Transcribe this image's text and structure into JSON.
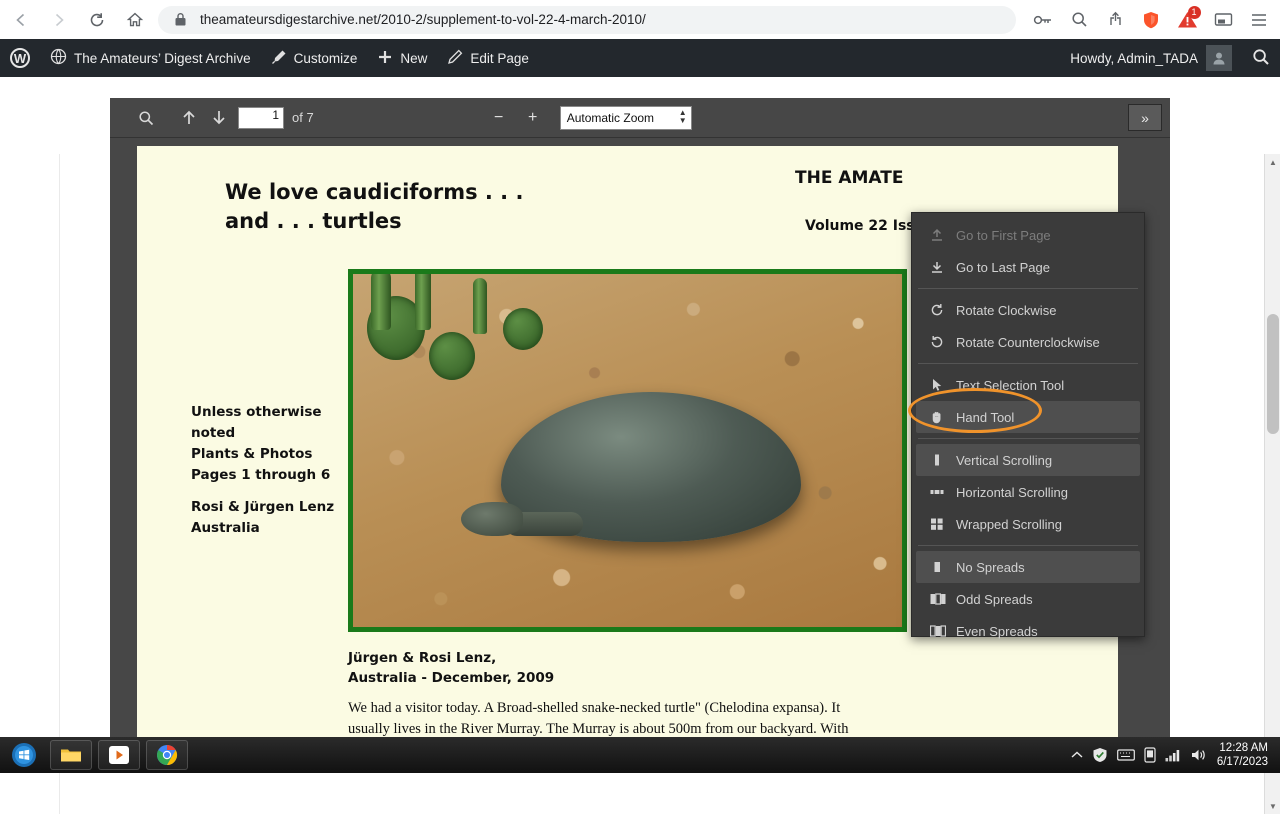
{
  "browser": {
    "url": "theamateursdigestarchive.net/2010-2/supplement-to-vol-22-4-march-2010/",
    "back_icon": "back-arrow-icon",
    "forward_icon": "forward-arrow-icon",
    "reload_icon": "reload-icon",
    "home_icon": "home-icon",
    "lock_icon": "lock-icon",
    "key_icon": "key-icon",
    "zoom_icon": "magnifier-icon",
    "share_icon": "share-icon",
    "shield_icon": "brave-shield-icon",
    "warning_icon": "warning-triangle-icon",
    "warning_badge": "1",
    "cast_icon": "cast-icon",
    "menu_icon": "hamburger-menu-icon"
  },
  "adminbar": {
    "logo": "wordpress-logo-icon",
    "site_name": "The Amateurs’ Digest Archive",
    "customize": "Customize",
    "new": "New",
    "edit_page": "Edit Page",
    "howdy": "Howdy, Admin_TADA",
    "search_icon": "search-icon"
  },
  "pdf_toolbar": {
    "find_icon": "magnifier-icon",
    "prev_page_icon": "up-arrow-icon",
    "next_page_icon": "down-arrow-icon",
    "page_number": "1",
    "page_count_label": "of 7",
    "zoom_out": "−",
    "zoom_in": "+",
    "zoom_level": "Automatic Zoom",
    "secondary_toggle": "»"
  },
  "secondary_menu": {
    "items": [
      {
        "label": "Go to First Page",
        "icon": "first-page-icon",
        "state": "disabled"
      },
      {
        "label": "Go to Last Page",
        "icon": "last-page-icon",
        "state": "normal"
      },
      {
        "label": "Rotate Clockwise",
        "icon": "rotate-cw-icon",
        "state": "normal"
      },
      {
        "label": "Rotate Counterclockwise",
        "icon": "rotate-ccw-icon",
        "state": "normal"
      },
      {
        "label": "Text Selection Tool",
        "icon": "cursor-arrow-icon",
        "state": "normal"
      },
      {
        "label": "Hand Tool",
        "icon": "hand-icon",
        "state": "selected"
      },
      {
        "label": "Vertical Scrolling",
        "icon": "vertical-scroll-icon",
        "state": "selected"
      },
      {
        "label": "Horizontal Scrolling",
        "icon": "horizontal-scroll-icon",
        "state": "normal"
      },
      {
        "label": "Wrapped Scrolling",
        "icon": "wrapped-scroll-icon",
        "state": "normal"
      },
      {
        "label": "No Spreads",
        "icon": "no-spreads-icon",
        "state": "selected"
      },
      {
        "label": "Odd Spreads",
        "icon": "odd-spreads-icon",
        "state": "normal"
      },
      {
        "label": "Even Spreads",
        "icon": "even-spreads-icon",
        "state": "normal"
      }
    ]
  },
  "pdf_page": {
    "title_line1": "We love caudiciforms . . .",
    "title_line2": "and . . . turtles",
    "masthead": "THE AMATE",
    "volume": "Volume 22 Iss",
    "sidebar_note_line1": "Unless otherwise",
    "sidebar_note_line2": "noted",
    "sidebar_note_line3": "Plants & Photos",
    "sidebar_note_line4": "Pages 1 through 6",
    "sidebar_credit_line1": "Rosi & Jürgen Lenz",
    "sidebar_credit_line2": "Australia",
    "photo_credit_line1": "Jürgen & Rosi Lenz,",
    "photo_credit_line2": "Australia  - December, 2009",
    "body_line1": "We had a visitor today.   A Broad-shelled snake-necked turtle\" (Chelodina expansa).  It",
    "body_line2": "usually  lives in the River Murray.  The Murray is about 500m from our backyard.  With"
  },
  "taskbar": {
    "start_icon": "windows-start-icon",
    "apps": [
      {
        "name": "file-explorer-icon"
      },
      {
        "name": "media-player-icon"
      },
      {
        "name": "chrome-icon"
      }
    ],
    "tray_icons": [
      "show-hidden-icon",
      "antivirus-icon",
      "keyboard-icon",
      "device-icon",
      "network-icon",
      "volume-icon"
    ],
    "time": "12:28 AM",
    "date": "6/17/2023"
  },
  "colors": {
    "accent_highlight": "#f0932b",
    "adminbar_bg": "#23282d",
    "pdf_chrome": "#474747",
    "menu_bg": "#3b3b3b",
    "photo_border": "#1a7a1a",
    "page_bg": "#fbfbe3"
  }
}
